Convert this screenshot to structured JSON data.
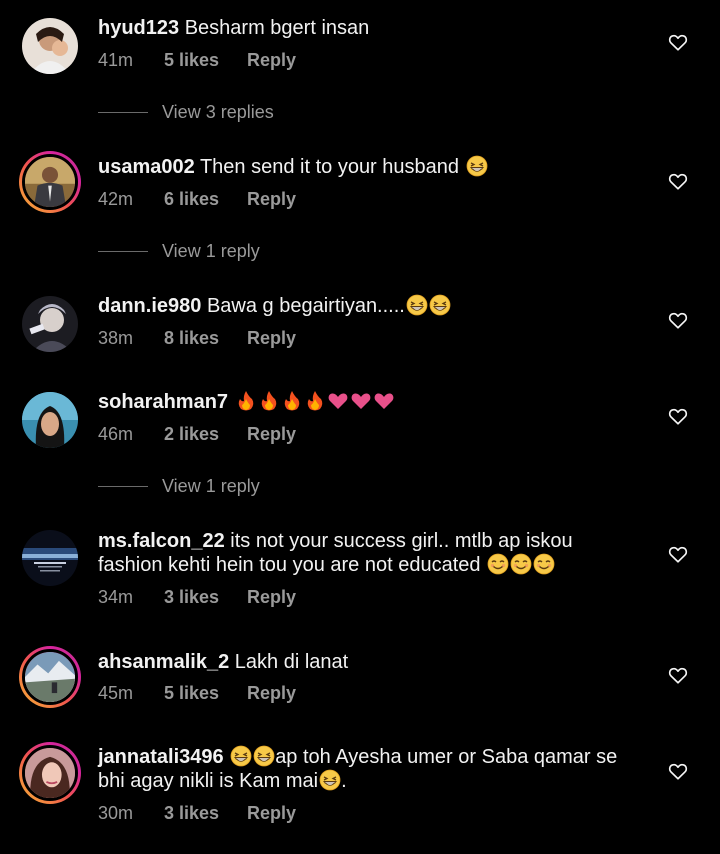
{
  "colors": {
    "background": "#000000",
    "text": "#f2f2f2",
    "muted": "#9a9a9a",
    "story_ring_start": "#f7b733",
    "story_ring_end": "#c13584"
  },
  "comments": [
    {
      "username": "hyud123",
      "text": "Besharm bgert insan",
      "time": "41m",
      "likes": "5 likes",
      "reply": "Reply",
      "view_replies": "View 3 replies",
      "story_ring": false
    },
    {
      "username": "usama002",
      "text": "Then send it to your husband",
      "emojis": [
        "grinning-squint-emoji"
      ],
      "time": "42m",
      "likes": "6 likes",
      "reply": "Reply",
      "view_replies": "View 1 reply",
      "story_ring": true
    },
    {
      "username": "dann.ie980",
      "text": "Bawa g begairtiyan.....",
      "emojis": [
        "grinning-squint-emoji",
        "grinning-squint-emoji"
      ],
      "time": "38m",
      "likes": "8 likes",
      "reply": "Reply",
      "story_ring": false
    },
    {
      "username": "soharahman7",
      "text": "",
      "emojis": [
        "fire-emoji",
        "fire-emoji",
        "fire-emoji",
        "fire-emoji",
        "pink-heart-emoji",
        "pink-heart-emoji",
        "pink-heart-emoji"
      ],
      "time": "46m",
      "likes": "2 likes",
      "reply": "Reply",
      "view_replies": "View 1 reply",
      "story_ring": false
    },
    {
      "username": "ms.falcon_22",
      "text": "its not your success girl.. mtlb ap iskou fashion kehti hein tou you are not educated",
      "emojis": [
        "smiling-emoji",
        "smiling-emoji",
        "smiling-emoji"
      ],
      "time": "34m",
      "likes": "3 likes",
      "reply": "Reply",
      "story_ring": false
    },
    {
      "username": "ahsanmalik_2",
      "text": "Lakh di lanat",
      "time": "45m",
      "likes": "5 likes",
      "reply": "Reply",
      "story_ring": true
    },
    {
      "username": "jannatali3496",
      "text_before": "",
      "text": "ap toh Ayesha umer or Saba qamar se bhi agay nikli is Kam mai",
      "text_after": ".",
      "time": "30m",
      "likes": "3 likes",
      "reply": "Reply",
      "story_ring": true
    }
  ]
}
